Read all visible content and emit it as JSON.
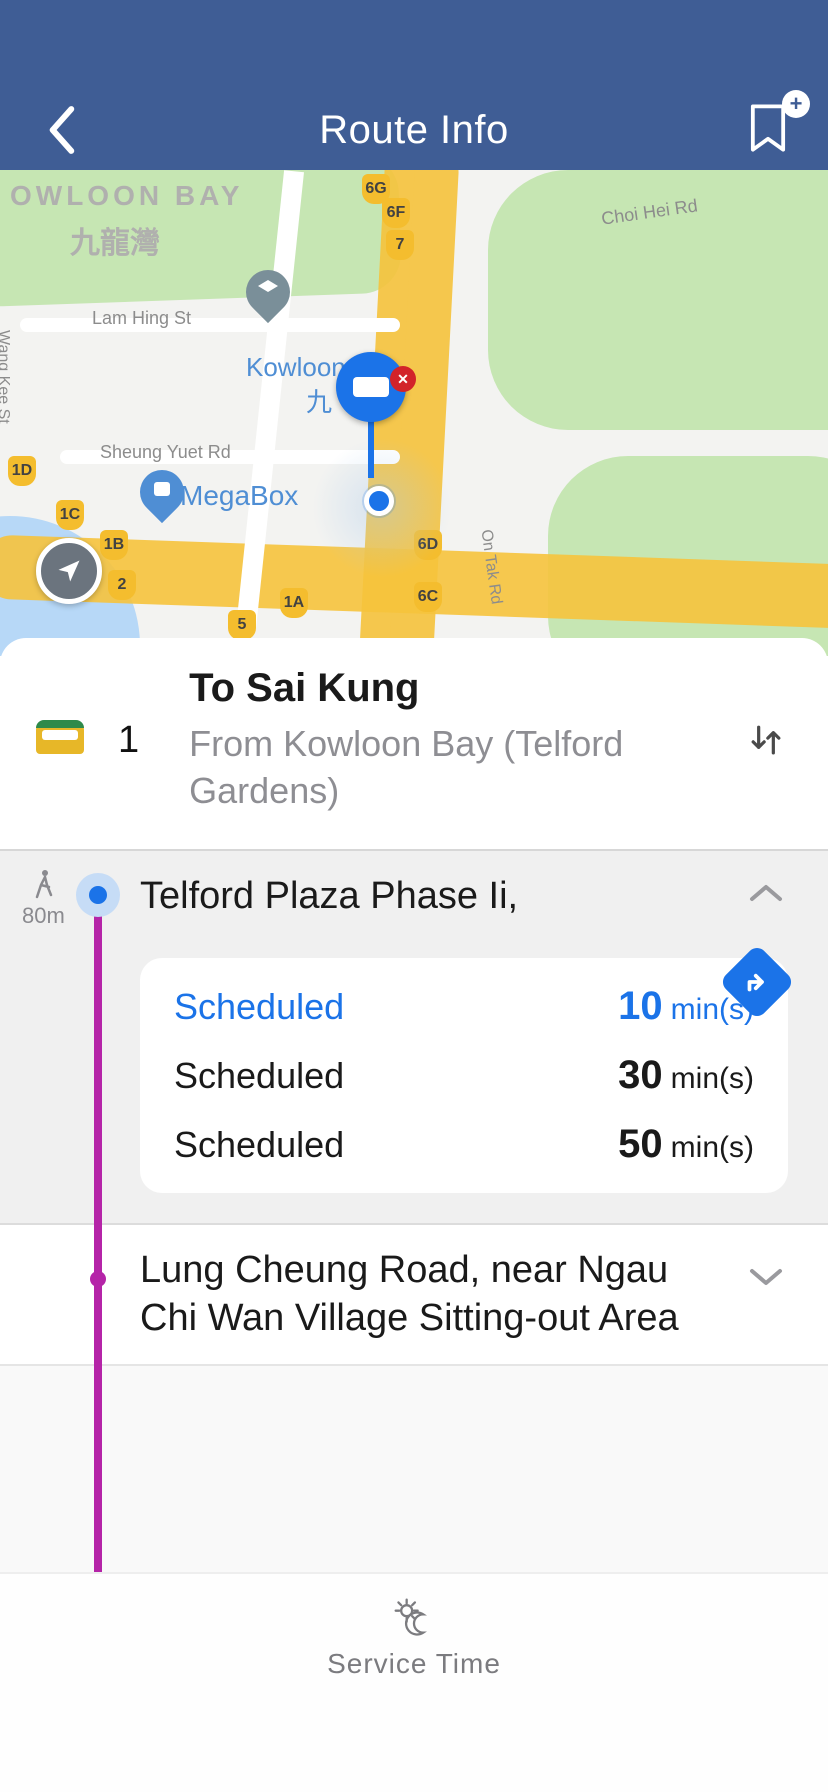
{
  "header": {
    "title": "Route Info"
  },
  "map": {
    "labels": {
      "kb_en": "OWLOON BAY",
      "kb_zh": "九龍灣",
      "lam_hing": "Lam Hing St",
      "sheung_yuet": "Sheung Yuet Rd",
      "wang_kee": "Wang Kee St",
      "choi_hei": "Choi Hei Rd",
      "on_tak": "On Tak Rd",
      "kowloon_en": "Kowloon",
      "kowloon_zh": "九",
      "megabox": "MegaBox"
    },
    "shields": {
      "s6g": "6G",
      "s6f": "6F",
      "s7": "7",
      "s1d": "1D",
      "s1c": "1C",
      "s1b": "1B",
      "s2": "2",
      "s1a": "1A",
      "s6d": "6D",
      "s6c": "6C",
      "s5": "5"
    }
  },
  "route": {
    "number": "1",
    "to_label": "To Sai Kung",
    "from_label": "From Kowloon Bay (Telford Gardens)"
  },
  "walk_distance": "80m",
  "stops": [
    {
      "name": "Telford Plaza Phase Ii,",
      "expanded": true,
      "schedule": [
        {
          "label": "Scheduled",
          "minutes": "10",
          "unit": "min(s)"
        },
        {
          "label": "Scheduled",
          "minutes": "30",
          "unit": "min(s)"
        },
        {
          "label": "Scheduled",
          "minutes": "50",
          "unit": "min(s)"
        }
      ]
    },
    {
      "name": "Lung Cheung Road, near Ngau Chi Wan Village Sitting-out Area",
      "expanded": false
    }
  ],
  "footer": {
    "service_time": "Service Time"
  }
}
